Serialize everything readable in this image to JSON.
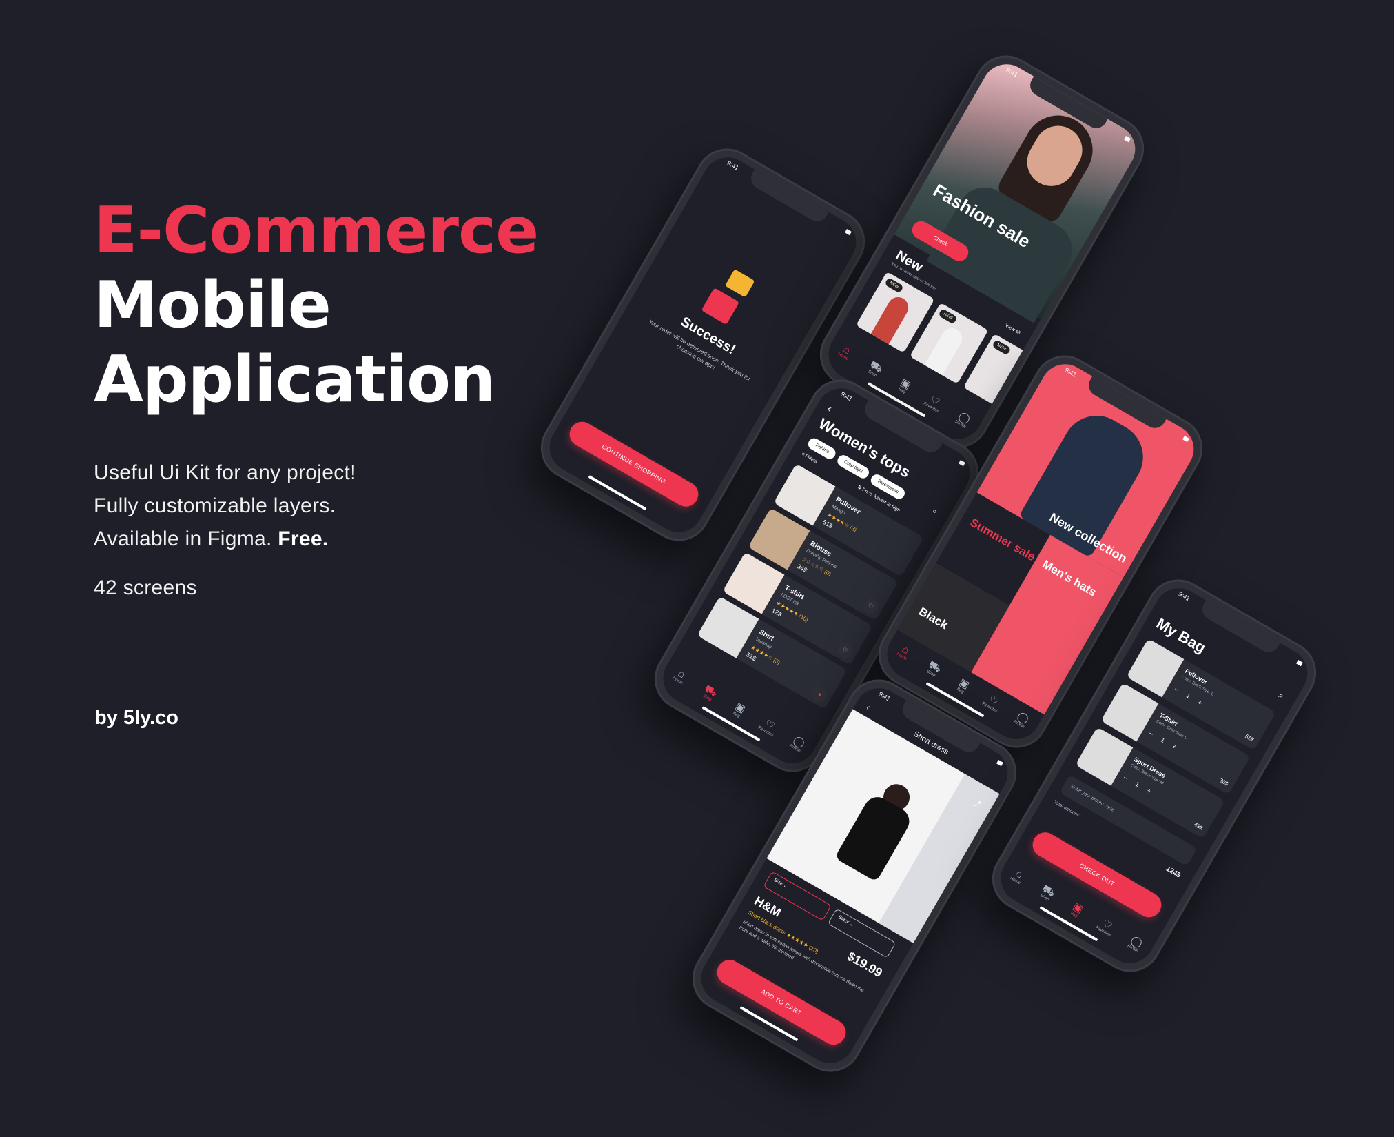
{
  "hero": {
    "title_accent": "E-Commerce",
    "title_line2": "Mobile",
    "title_line3": "Application",
    "line1": "Useful Ui Kit for any project!",
    "line2": "Fully customizable layers.",
    "line3_a": "Available in Figma.",
    "line3_b": "Free.",
    "screens": "42 screens",
    "byline": "by 5ly.co"
  },
  "colors": {
    "background": "#1e1f28",
    "accent": "#ef3651",
    "surface": "#2a2c36",
    "star": "#f5b431"
  },
  "status_time": "9:41",
  "success": {
    "title": "Success!",
    "text": "Your order will be delivered soon. Thank you for choosing our app!",
    "button": "CONTINUE SHOPPING"
  },
  "home": {
    "hero_title": "Fashion sale",
    "hero_button": "Check",
    "new_title": "New",
    "new_sub": "You've never seen it before!",
    "view_all": "View all",
    "badge": "NEW",
    "nav": [
      "Home",
      "Shop",
      "Bag",
      "Favorites",
      "Profile"
    ]
  },
  "list": {
    "title": "Women's tops",
    "chips": [
      "T-shirts",
      "Crop tops",
      "Sleeveless"
    ],
    "filters": "Filters",
    "sort": "Price: lowest to high",
    "items": [
      {
        "name": "Pullover",
        "brand": "Mango",
        "rating": "★★★★☆ (3)",
        "price": "51$"
      },
      {
        "name": "Blouse",
        "brand": "Dorothy Perkins",
        "rating": "☆☆☆☆☆ (0)",
        "price": "34$"
      },
      {
        "name": "T-shirt",
        "brand": "LOST Ink",
        "rating": "★★★★★ (10)",
        "price": "12$"
      },
      {
        "name": "Shirt",
        "brand": "Topshop",
        "rating": "★★★★☆ (3)",
        "price": "51$"
      }
    ]
  },
  "shop": {
    "new_collection": "New collection",
    "summer_sale": "Summer sale",
    "mens_hats": "Men's hats",
    "black": "Black"
  },
  "detail": {
    "title": "Short dress",
    "size_label": "Size",
    "color_label": "Black",
    "brand": "H&M",
    "subtitle": "Short black dress",
    "rating": "★★★★★ (10)",
    "price": "$19.99",
    "desc": "Short dress in soft cotton jersey with decorative buttons down the front and a wide, frill-trimmed",
    "button": "ADD TO CART"
  },
  "bag": {
    "title": "My Bag",
    "items": [
      {
        "name": "Pullover",
        "meta": "Color: Black   Size: L",
        "qty": "– 1 +",
        "price": "51$"
      },
      {
        "name": "T-Shirt",
        "meta": "Color: Gray   Size: L",
        "qty": "– 1 +",
        "price": "30$"
      },
      {
        "name": "Sport Dress",
        "meta": "Color: Black   Size: M",
        "qty": "– 1 +",
        "price": "43$"
      }
    ],
    "promo_placeholder": "Enter your promo code",
    "total_label": "Total amount:",
    "total": "124$",
    "button": "CHECK OUT"
  }
}
